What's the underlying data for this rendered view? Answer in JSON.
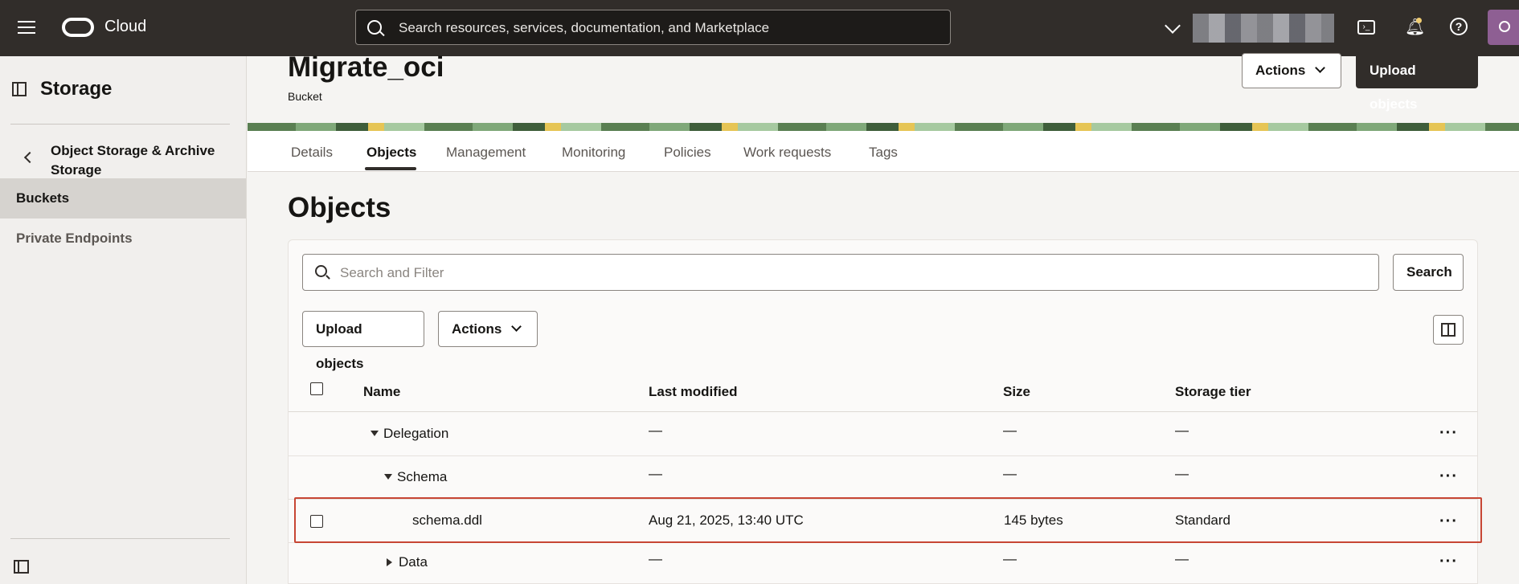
{
  "topbar": {
    "brand": "Cloud",
    "search_placeholder": "Search resources, services, documentation, and Marketplace"
  },
  "sidebar": {
    "title": "Storage",
    "parent": "Object Storage & Archive Storage",
    "items": [
      {
        "label": "Buckets",
        "active": true
      },
      {
        "label": "Private Endpoints",
        "active": false
      }
    ]
  },
  "header": {
    "title": "Migrate_oci",
    "subtitle": "Bucket",
    "actions_label": "Actions",
    "upload_label": "Upload objects"
  },
  "tabs": [
    {
      "label": "Details"
    },
    {
      "label": "Objects",
      "active": true
    },
    {
      "label": "Management"
    },
    {
      "label": "Monitoring"
    },
    {
      "label": "Policies"
    },
    {
      "label": "Work requests"
    },
    {
      "label": "Tags"
    }
  ],
  "objects": {
    "title": "Objects",
    "filter_placeholder": "Search and Filter",
    "search_button": "Search",
    "upload_button": "Upload objects",
    "actions_button": "Actions",
    "columns": [
      "Name",
      "Last modified",
      "Size",
      "Storage tier"
    ],
    "rows": [
      {
        "name": "Delegation",
        "modified": "—",
        "size": "—",
        "tier": "—",
        "expanded": true
      },
      {
        "name": "Schema",
        "modified": "—",
        "size": "—",
        "tier": "—",
        "expanded": true
      },
      {
        "name": "schema.ddl",
        "modified": "Aug 21, 2025, 13:40 UTC",
        "size": "145 bytes",
        "tier": "Standard",
        "highlighted": true
      },
      {
        "name": "Data",
        "modified": "—",
        "size": "—",
        "tier": "—",
        "expanded": false
      }
    ]
  },
  "colors": {
    "topbar": "#312d2a",
    "highlight": "#c74634",
    "avatar": "#8e5f93"
  }
}
